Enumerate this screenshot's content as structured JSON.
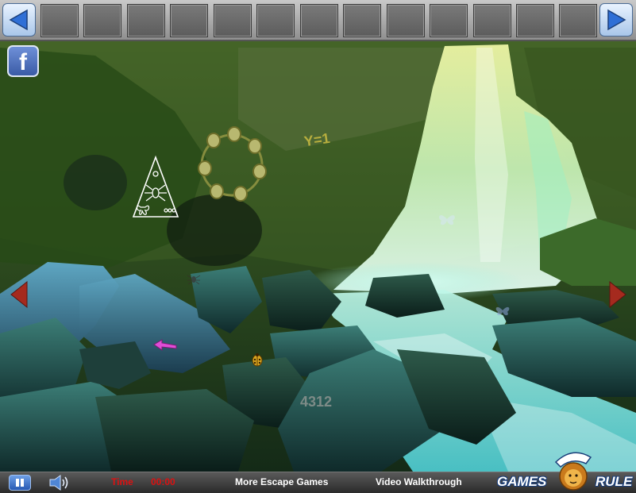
{
  "inventory": {
    "slot_count": 13
  },
  "scene": {
    "clue_text": "Y=1",
    "code_text": "4312"
  },
  "bottom": {
    "time_label": "Time",
    "time_value": "00:00",
    "more_games": "More Escape Games",
    "walkthrough": "Video Walkthrough",
    "logo_left": "GAMES",
    "logo_right": "RULE"
  },
  "colors": {
    "accent_blue": "#2f6fd6",
    "time_red": "#d11111",
    "water": "#bff7e8"
  }
}
